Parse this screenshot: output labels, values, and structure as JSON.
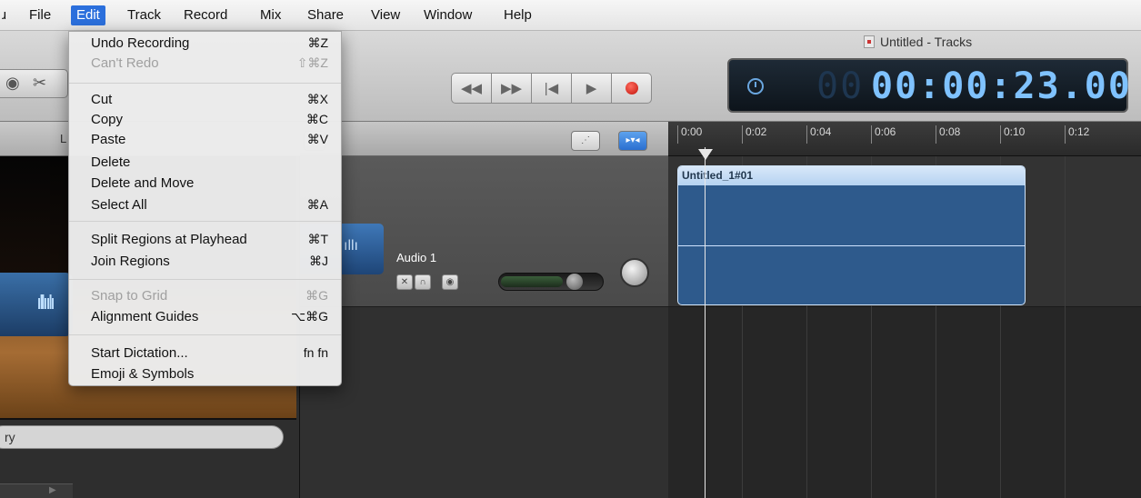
{
  "menubar": {
    "apple_partial": "ɹ",
    "items": [
      "File",
      "Edit",
      "Track",
      "Record",
      "Mix",
      "Share",
      "View",
      "Window",
      "Help"
    ],
    "active": "Edit"
  },
  "window": {
    "title": "Untitled - Tracks"
  },
  "lcd": {
    "dim_prefix": "00",
    "time": "00:00:23.00"
  },
  "library": {
    "header_partial": "L",
    "search_partial": "ry"
  },
  "track": {
    "name": "Audio 1"
  },
  "ruler": {
    "ticks": [
      "0:00",
      "0:02",
      "0:04",
      "0:06",
      "0:08",
      "0:10",
      "0:12"
    ]
  },
  "region": {
    "title": "Untitled_1#01"
  },
  "edit_menu": {
    "items": [
      {
        "label": "Undo Recording",
        "shortcut": "⌘Z",
        "enabled": true
      },
      {
        "label": "Can't Redo",
        "shortcut": "⇧⌘Z",
        "enabled": false
      },
      {
        "label": "Cut",
        "shortcut": "⌘X",
        "enabled": true
      },
      {
        "label": "Copy",
        "shortcut": "⌘C",
        "enabled": true
      },
      {
        "label": "Paste",
        "shortcut": "⌘V",
        "enabled": true
      },
      {
        "label": "Delete",
        "shortcut": "",
        "enabled": true
      },
      {
        "label": "Delete and Move",
        "shortcut": "",
        "enabled": true
      },
      {
        "label": "Select All",
        "shortcut": "⌘A",
        "enabled": true
      },
      {
        "label": "Split Regions at Playhead",
        "shortcut": "⌘T",
        "enabled": true
      },
      {
        "label": "Join Regions",
        "shortcut": "⌘J",
        "enabled": true
      },
      {
        "label": "Snap to Grid",
        "shortcut": "⌘G",
        "enabled": false
      },
      {
        "label": "Alignment Guides",
        "shortcut": "⌥⌘G",
        "enabled": true
      },
      {
        "label": "Start Dictation...",
        "shortcut": "fn fn",
        "enabled": true
      },
      {
        "label": "Emoji & Symbols",
        "shortcut": "",
        "enabled": true
      }
    ]
  }
}
